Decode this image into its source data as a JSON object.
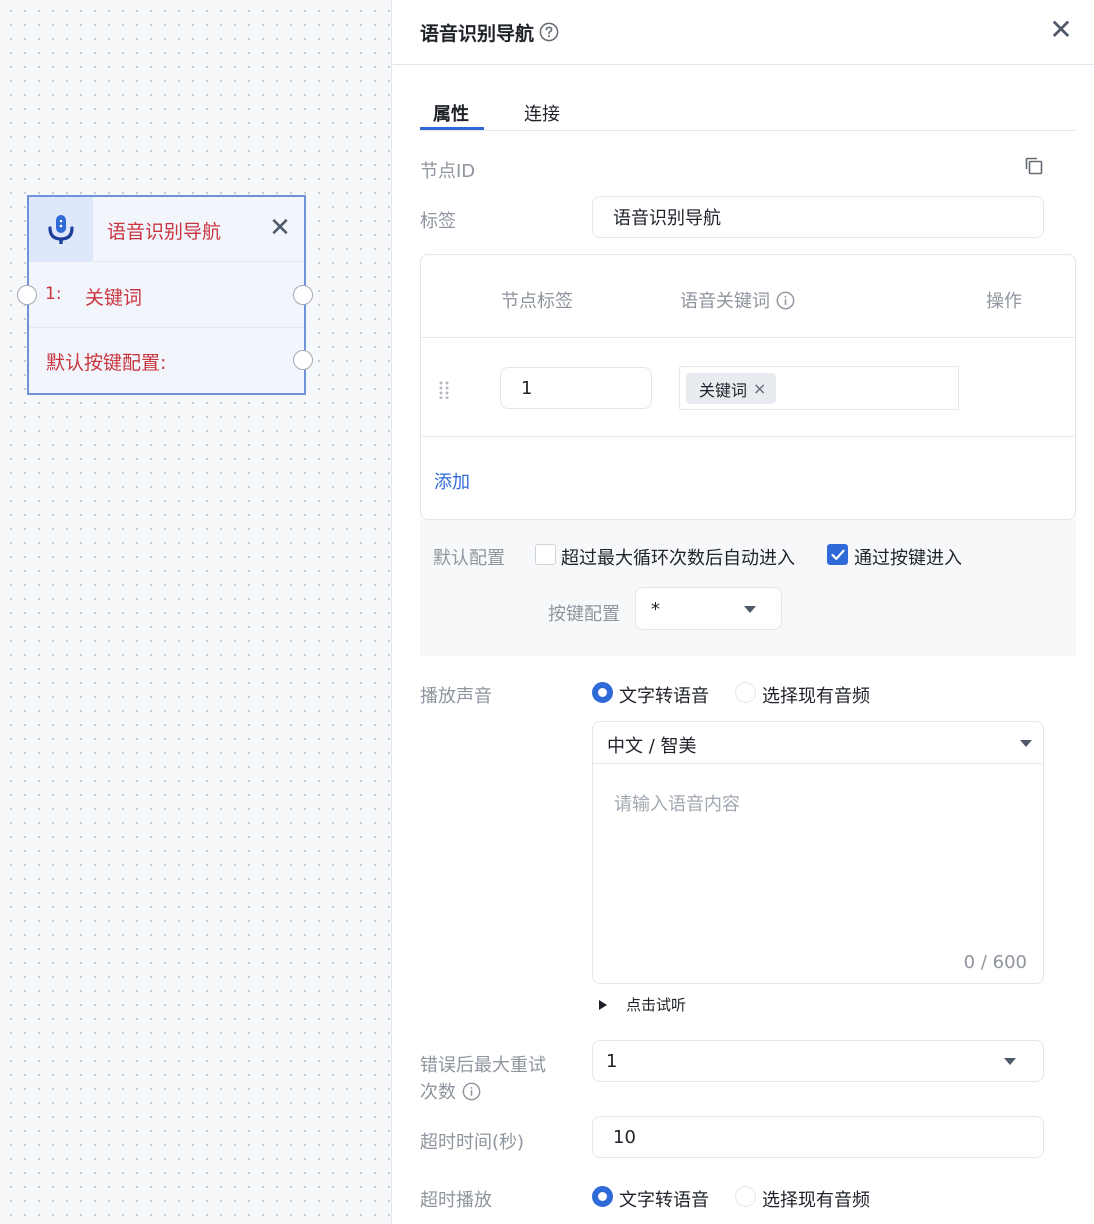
{
  "node": {
    "title": "语音识别导航",
    "icon": "microphone-icon",
    "close": "✕",
    "rows": [
      {
        "index": "1:",
        "keyword": "关键词"
      }
    ],
    "default_row": "默认按键配置:"
  },
  "panel": {
    "title": "语音识别导航",
    "close": "✕",
    "tabs": [
      "属性",
      "连接"
    ],
    "node_id_label": "节点ID",
    "tag_label": "标签",
    "tag_value": "语音识别导航",
    "table": {
      "headers": [
        "节点标签",
        "语音关键词",
        "操作"
      ],
      "rows": [
        {
          "label": "1",
          "keywords": [
            "关键词"
          ]
        }
      ],
      "add": "添加"
    },
    "default_config": {
      "label": "默认配置",
      "option1": "超过最大循环次数后自动进入",
      "option1_checked": false,
      "option2": "通过按键进入",
      "option2_checked": true,
      "key_label": "按键配置",
      "key_value": "*"
    },
    "play_sound": {
      "label": "播放声音",
      "radio1": "文字转语音",
      "radio2": "选择现有音频",
      "selected": "文字转语音",
      "voice": "中文 / 智美",
      "placeholder": "请输入语音内容",
      "counter": "0 / 600",
      "preview": "点击试听"
    },
    "retry": {
      "label_line1": "错误后最大重试",
      "label_line2": "次数",
      "value": "1"
    },
    "timeout": {
      "label": "超时时间(秒)",
      "value": "10"
    },
    "timeout_play": {
      "label": "超时播放",
      "radio1": "文字转语音",
      "radio2": "选择现有音频",
      "selected": "文字转语音"
    }
  },
  "colors": {
    "accent": "#2f6bd8",
    "node_text": "#c9353f",
    "node_border": "#6f93d9"
  }
}
